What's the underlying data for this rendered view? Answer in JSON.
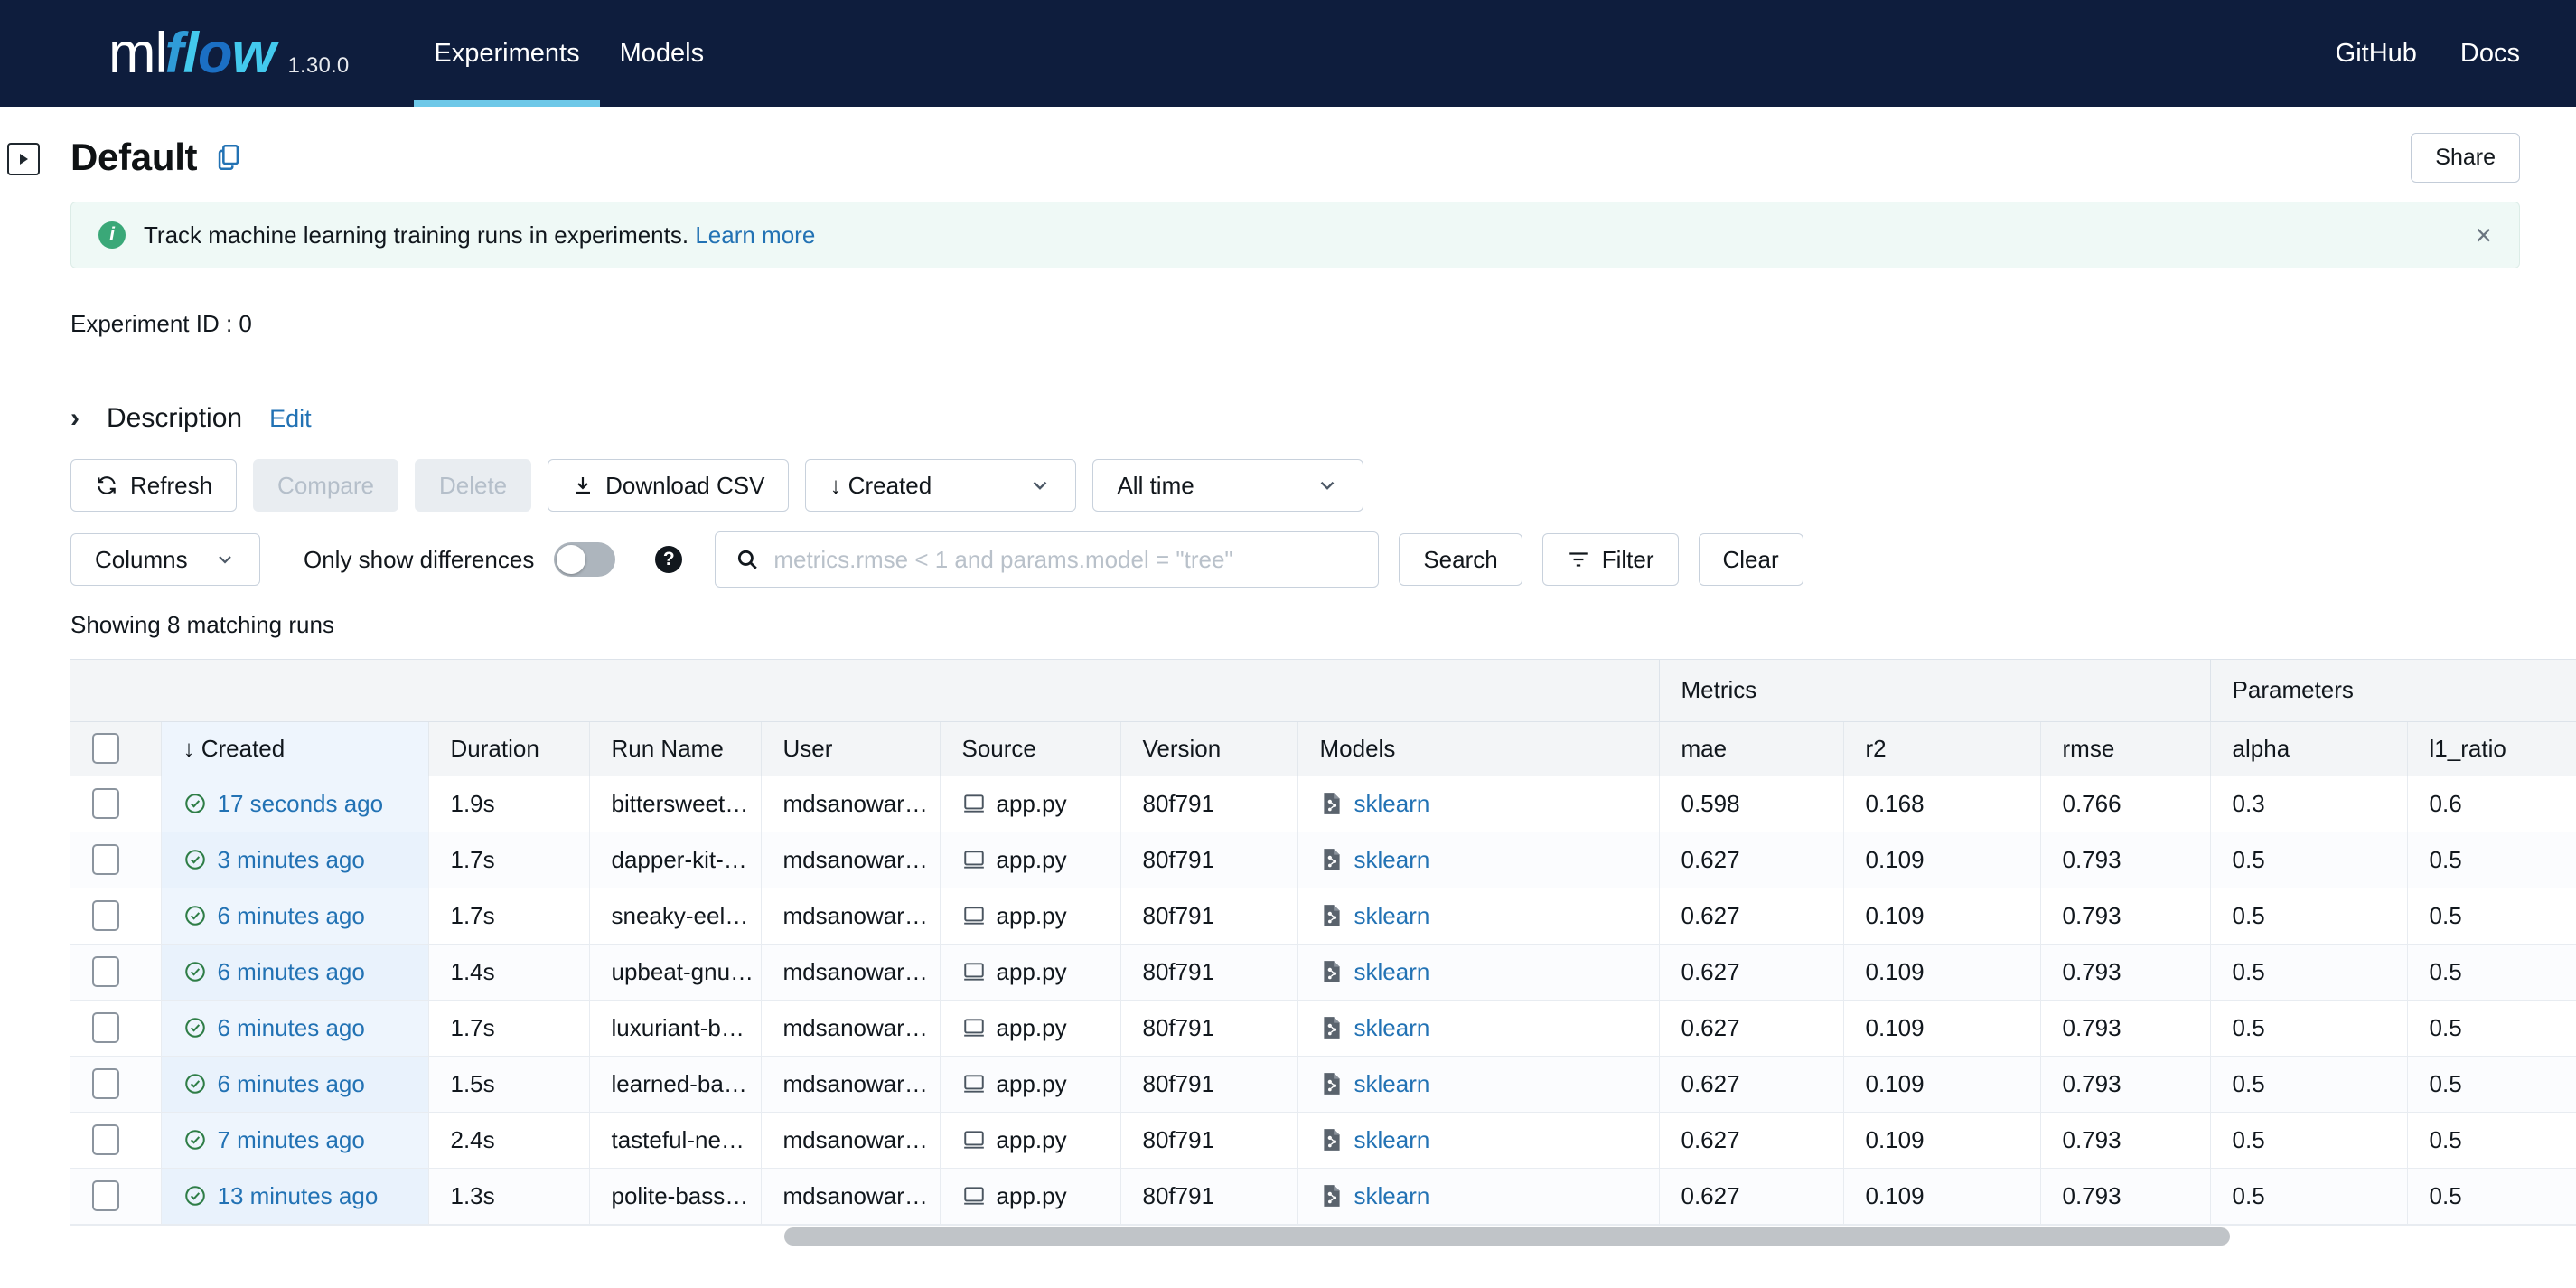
{
  "nav": {
    "logo_ml": "ml",
    "logo_flow": "flow",
    "version": "1.30.0",
    "links": [
      {
        "label": "Experiments",
        "active": true
      },
      {
        "label": "Models",
        "active": false
      }
    ],
    "right_links": [
      {
        "label": "GitHub"
      },
      {
        "label": "Docs"
      }
    ]
  },
  "header": {
    "title": "Default",
    "copy_icon": "copy-icon",
    "share_label": "Share",
    "sidebar_toggle_icon": "panel-expand-icon"
  },
  "banner": {
    "icon": "info-icon",
    "text": "Track machine learning training runs in experiments.",
    "link_label": "Learn more",
    "close_icon": "close-icon",
    "background": "#eff9f6",
    "icon_color": "#3aa878"
  },
  "experiment": {
    "id_label": "Experiment ID :",
    "id_value": "0"
  },
  "description": {
    "chevron_icon": "chevron-right-icon",
    "label": "Description",
    "edit_label": "Edit"
  },
  "toolbar": {
    "refresh_label": "Refresh",
    "refresh_icon": "refresh-icon",
    "compare_label": "Compare",
    "compare_disabled": true,
    "delete_label": "Delete",
    "delete_disabled": true,
    "download_label": "Download CSV",
    "download_icon": "download-icon",
    "sort_label": "↓ Created",
    "sort_caret_icon": "chevron-down-icon",
    "time_label": "All time",
    "time_caret_icon": "chevron-down-icon"
  },
  "filterbar": {
    "columns_label": "Columns",
    "columns_caret_icon": "chevron-down-icon",
    "differences_label": "Only show differences",
    "differences_toggle_on": false,
    "help_icon": "question-mark-icon",
    "search_icon": "search-icon",
    "search_value": "",
    "search_placeholder": "metrics.rmse < 1 and params.model = \"tree\"",
    "search_label": "Search",
    "filter_label": "Filter",
    "filter_icon": "filter-icon",
    "clear_label": "Clear"
  },
  "results": {
    "showing_text": "Showing 8 matching runs"
  },
  "table": {
    "groups": [
      {
        "label": "",
        "span": 8
      },
      {
        "label": "Metrics",
        "span": 3
      },
      {
        "label": "Parameters",
        "span": 2
      }
    ],
    "columns": [
      "",
      "↓ Created",
      "Duration",
      "Run Name",
      "User",
      "Source",
      "Version",
      "Models",
      "mae",
      "r2",
      "rmse",
      "alpha",
      "l1_ratio"
    ],
    "status_icon": "check-circle-icon",
    "source_icon": "monitor-icon",
    "model_icon": "model-file-icon",
    "rows": [
      {
        "created": "17 seconds ago",
        "duration": "1.9s",
        "run_name": "bittersweet…",
        "user": "mdsanowar…",
        "source": "app.py",
        "version": "80f791",
        "model": "sklearn",
        "mae": "0.598",
        "r2": "0.168",
        "rmse": "0.766",
        "alpha": "0.3",
        "l1_ratio": "0.6"
      },
      {
        "created": "3 minutes ago",
        "duration": "1.7s",
        "run_name": "dapper-kit-…",
        "user": "mdsanowar…",
        "source": "app.py",
        "version": "80f791",
        "model": "sklearn",
        "mae": "0.627",
        "r2": "0.109",
        "rmse": "0.793",
        "alpha": "0.5",
        "l1_ratio": "0.5"
      },
      {
        "created": "6 minutes ago",
        "duration": "1.7s",
        "run_name": "sneaky-eel…",
        "user": "mdsanowar…",
        "source": "app.py",
        "version": "80f791",
        "model": "sklearn",
        "mae": "0.627",
        "r2": "0.109",
        "rmse": "0.793",
        "alpha": "0.5",
        "l1_ratio": "0.5"
      },
      {
        "created": "6 minutes ago",
        "duration": "1.4s",
        "run_name": "upbeat-gnu…",
        "user": "mdsanowar…",
        "source": "app.py",
        "version": "80f791",
        "model": "sklearn",
        "mae": "0.627",
        "r2": "0.109",
        "rmse": "0.793",
        "alpha": "0.5",
        "l1_ratio": "0.5"
      },
      {
        "created": "6 minutes ago",
        "duration": "1.7s",
        "run_name": "luxuriant-b…",
        "user": "mdsanowar…",
        "source": "app.py",
        "version": "80f791",
        "model": "sklearn",
        "mae": "0.627",
        "r2": "0.109",
        "rmse": "0.793",
        "alpha": "0.5",
        "l1_ratio": "0.5"
      },
      {
        "created": "6 minutes ago",
        "duration": "1.5s",
        "run_name": "learned-ba…",
        "user": "mdsanowar…",
        "source": "app.py",
        "version": "80f791",
        "model": "sklearn",
        "mae": "0.627",
        "r2": "0.109",
        "rmse": "0.793",
        "alpha": "0.5",
        "l1_ratio": "0.5"
      },
      {
        "created": "7 minutes ago",
        "duration": "2.4s",
        "run_name": "tasteful-ne…",
        "user": "mdsanowar…",
        "source": "app.py",
        "version": "80f791",
        "model": "sklearn",
        "mae": "0.627",
        "r2": "0.109",
        "rmse": "0.793",
        "alpha": "0.5",
        "l1_ratio": "0.5"
      },
      {
        "created": "13 minutes ago",
        "duration": "1.3s",
        "run_name": "polite-bass…",
        "user": "mdsanowar…",
        "source": "app.py",
        "version": "80f791",
        "model": "sklearn",
        "mae": "0.627",
        "r2": "0.109",
        "rmse": "0.793",
        "alpha": "0.5",
        "l1_ratio": "0.5"
      }
    ]
  },
  "colors": {
    "nav_background": "#0e1d3d",
    "accent": "#2272b4",
    "active_tab_underline": "#6ec8e8",
    "success": "#2e7d46"
  }
}
